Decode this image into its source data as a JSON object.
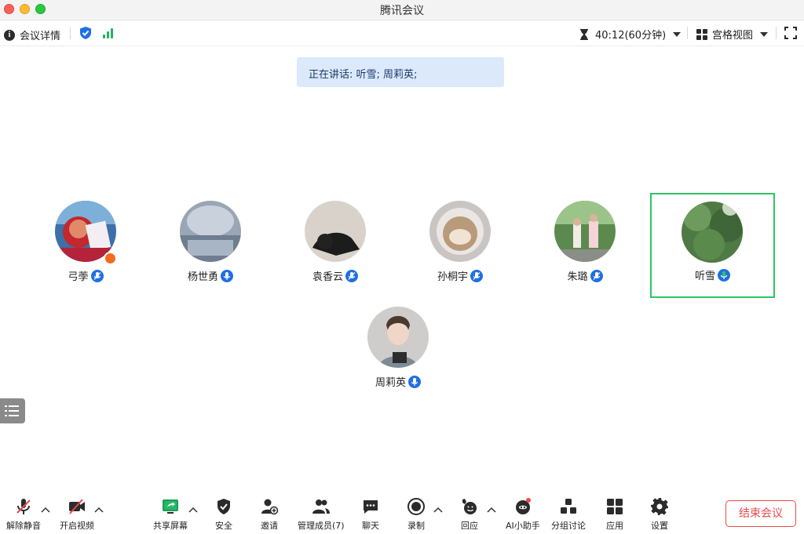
{
  "window": {
    "title": "腾讯会议"
  },
  "topbar": {
    "meeting_info_label": "会议详情",
    "timer_text": "40:12(60分钟)",
    "view_label": "宫格视图"
  },
  "speaking_banner": {
    "text": "正在讲话: 听雪; 周莉英;"
  },
  "participants": [
    {
      "name": "弓荸",
      "mic": "muted",
      "host": true
    },
    {
      "name": "杨世勇",
      "mic": "on"
    },
    {
      "name": "袁香云",
      "mic": "muted"
    },
    {
      "name": "孙桐宇",
      "mic": "muted"
    },
    {
      "name": "朱璐",
      "mic": "muted"
    },
    {
      "name": "听雪",
      "mic": "speaking",
      "active": true
    },
    {
      "name": "周莉英",
      "mic": "on"
    }
  ],
  "toolbar": {
    "unmute_label": "解除静音",
    "start_video_label": "开启视频",
    "share_screen_label": "共享屏幕",
    "security_label": "安全",
    "invite_label": "邀请",
    "manage_members_label": "管理成员(7)",
    "chat_label": "聊天",
    "record_label": "录制",
    "reaction_label": "回应",
    "ai_assistant_label": "AI小助手",
    "breakout_label": "分组讨论",
    "apps_label": "应用",
    "settings_label": "设置",
    "end_meeting_label": "结束会议"
  },
  "colors": {
    "accent_blue": "#1f6fe5",
    "speaking_green": "#2cc565",
    "end_red": "#e84a4a",
    "banner_bg": "#dbe9fb"
  }
}
